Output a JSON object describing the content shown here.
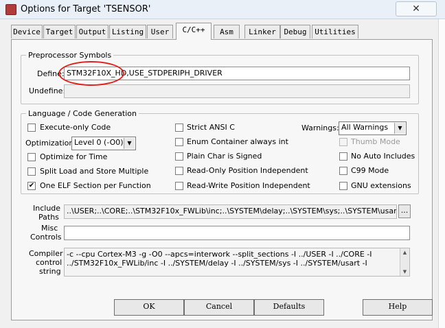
{
  "window": {
    "title": "Options for Target 'TSENSOR'",
    "close_glyph": "✕"
  },
  "tabs": [
    "Device",
    "Target",
    "Output",
    "Listing",
    "User",
    "C/C++",
    "Asm",
    "Linker",
    "Debug",
    "Utilities"
  ],
  "active_tab": "C/C++",
  "preprocessor": {
    "legend": "Preprocessor Symbols",
    "define_label": "Define:",
    "define_value": "STM32F10X_HD,USE_STDPERIPH_DRIVER",
    "undefine_label": "Undefine:",
    "undefine_value": ""
  },
  "language": {
    "legend": "Language / Code Generation",
    "execute_only": "Execute-only Code",
    "optimization_label": "Optimization:",
    "optimization_value": "Level 0 (-O0)",
    "optimize_time": "Optimize for Time",
    "split_load": "Split Load and Store Multiple",
    "one_elf": "One ELF Section per Function",
    "strict_ansi": "Strict ANSI C",
    "enum_container": "Enum Container always int",
    "plain_char": "Plain Char is Signed",
    "ropi": "Read-Only Position Independent",
    "rwpi": "Read-Write Position Independent",
    "warnings_label": "Warnings:",
    "warnings_value": "All Warnings",
    "thumb_mode": "Thumb Mode",
    "no_auto_includes": "No Auto Includes",
    "c99_mode": "C99 Mode",
    "gnu_extensions": "GNU extensions",
    "checked_mark": "✔"
  },
  "include": {
    "label_1": "Include",
    "label_2": "Paths",
    "value": "..\\USER;..\\CORE;..\\STM32F10x_FWLib\\inc;..\\SYSTEM\\delay;..\\SYSTEM\\sys;..\\SYSTEM\\usart;..\\",
    "browse": "..."
  },
  "misc": {
    "label_1": "Misc",
    "label_2": "Controls",
    "value": ""
  },
  "compiler": {
    "label_1": "Compiler",
    "label_2": "control",
    "label_3": "string",
    "line_1": "-c --cpu Cortex-M3 -g -O0 --apcs=interwork --split_sections -I ../USER -I ../CORE -I",
    "line_2": "../STM32F10x_FWLib/inc -I ../SYSTEM/delay -I ../SYSTEM/sys -I ../SYSTEM/usart -I"
  },
  "buttons": {
    "ok": "OK",
    "cancel": "Cancel",
    "defaults": "Defaults",
    "help": "Help"
  },
  "colors": {
    "annotation": "#e0201a"
  }
}
